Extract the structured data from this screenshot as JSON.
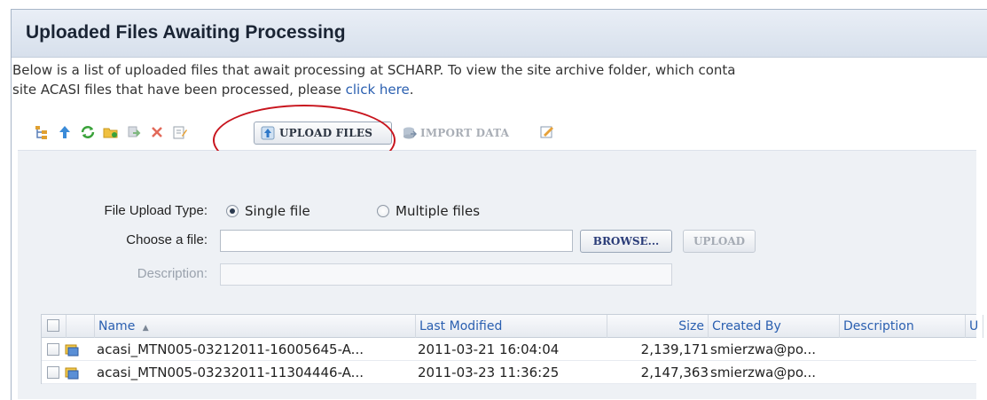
{
  "panel": {
    "title": "Uploaded Files Awaiting Processing"
  },
  "intro": {
    "line1": "Below is a list of uploaded files that await processing at SCHARP. To view the site archive folder, which conta",
    "line2_prefix": "site ACASI files that have been processed, please ",
    "link_text": "click here",
    "line2_suffix": "."
  },
  "toolbar": {
    "upload_files_label": "UPLOAD FILES",
    "import_data_label": "IMPORT DATA",
    "icons": [
      "tree-icon",
      "up-arrow-icon",
      "refresh-icon",
      "new-folder-icon",
      "move-icon",
      "delete-icon",
      "edit-properties-icon",
      "upload-icon",
      "import-icon",
      "edit-icon"
    ]
  },
  "upload_form": {
    "type_label": "File Upload Type:",
    "options": [
      "Single file",
      "Multiple files"
    ],
    "selected_option": "Single file",
    "choose_label": "Choose a file:",
    "file_value": "",
    "browse_label": "BROWSE...",
    "upload_label": "UPLOAD",
    "description_label": "Description:",
    "description_value": ""
  },
  "grid": {
    "columns": [
      "Name",
      "Last Modified",
      "Size",
      "Created By",
      "Description",
      "U"
    ],
    "sort_indicator": "▲",
    "rows": [
      {
        "name": "acasi_MTN005-03212011-16005645-A...",
        "modified": "2011-03-21 16:04:04",
        "size": "2,139,171",
        "created_by": "smierzwa@po...",
        "description": ""
      },
      {
        "name": "acasi_MTN005-03232011-11304446-A...",
        "modified": "2011-03-23 11:36:25",
        "size": "2,147,363",
        "created_by": "smierzwa@po...",
        "description": ""
      }
    ]
  },
  "colors": {
    "link": "#2a5fb0",
    "highlight_circle": "#c8141d",
    "title_bar": "#dde5f0"
  }
}
